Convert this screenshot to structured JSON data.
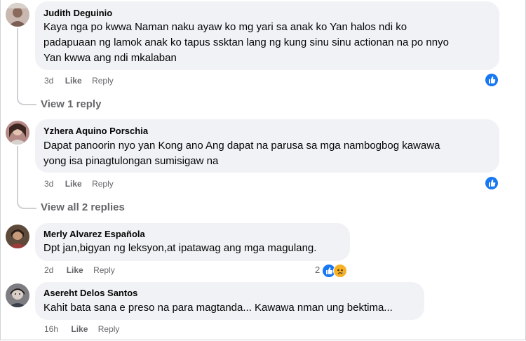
{
  "comments": [
    {
      "author": "Judith Deguinio",
      "lines": [
        "Kaya nga po kwwa Naman naku ayaw ko mg yari sa anak ko Yan halos ndi ko",
        "padapuaan ng lamok anak ko tapus ssktan lang ng kung sinu sinu actionan na po nnyo",
        "Yan kwwa ang ndi mkalaban"
      ],
      "time": "3d",
      "like": "Like",
      "reply": "Reply",
      "reactions": "like-reaction-icon",
      "view_replies": "View 1 reply"
    },
    {
      "author": "Yzhera Aquino Porschia",
      "lines": [
        "Dapat panoorin nyo yan Kong ano Ang dapat na parusa sa mga nambogbog kawawa",
        "yong isa pinagtulongan sumisigaw na"
      ],
      "time": "3d",
      "like": "Like",
      "reply": "Reply",
      "reactions": "like-reaction-icon",
      "view_replies": "View all 2 replies"
    },
    {
      "author": "Merly Alvarez Española",
      "lines": [
        "Dpt jan,bigyan ng leksyon,at ipatawag ang mga magulang."
      ],
      "time": "2d",
      "like": "Like",
      "reply": "Reply",
      "reaction_count": "2",
      "reactions": "like-and-sad-reaction-icons"
    },
    {
      "author": "Asereht Delos Santos",
      "lines": [
        "Kahit bata sana e preso na para magtanda... Kawawa nman ung bektima..."
      ],
      "time": "16h",
      "like": "Like",
      "reply": "Reply"
    }
  ],
  "colors": {
    "bubble": "#f0f2f5",
    "meta": "#65676b",
    "like_blue": "#1877f2",
    "sad_yellow": "#f7b125"
  }
}
